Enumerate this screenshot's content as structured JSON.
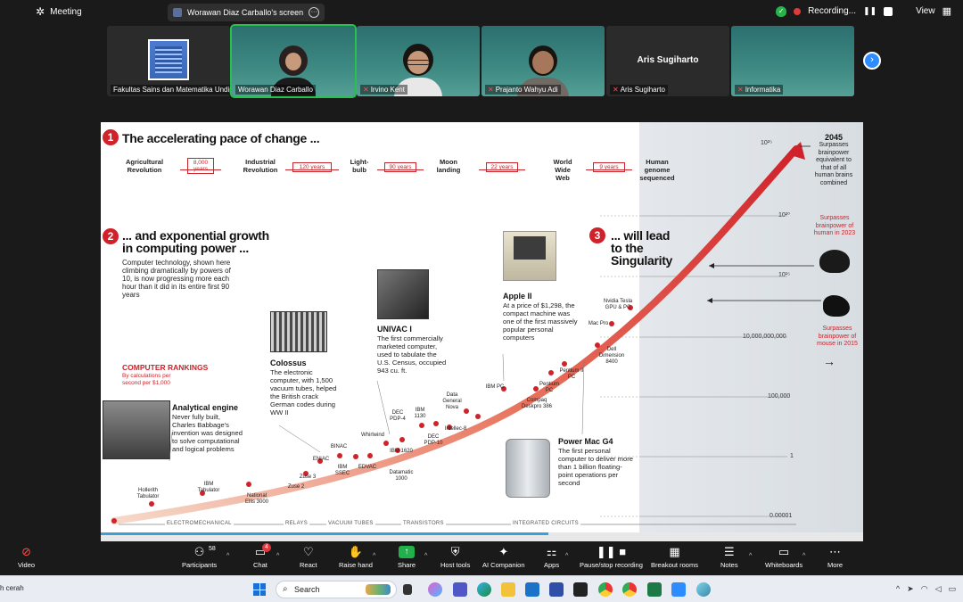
{
  "topbar": {
    "meeting_label": "Meeting",
    "share_label": "Worawan Diaz Carballo's screen",
    "recording_label": "Recording...",
    "view_label": "View"
  },
  "participants": [
    {
      "name": "Fakultas Sains dan Matematika Undip",
      "muted": false,
      "type": "building"
    },
    {
      "name": "Worawan Diaz Carballo",
      "muted": false,
      "type": "person-slide",
      "active": true
    },
    {
      "name": "Irvino Kent",
      "muted": true,
      "type": "person-slide"
    },
    {
      "name": "Prajanto Wahyu Adi",
      "muted": true,
      "type": "person-slide"
    },
    {
      "name": "Aris Sugiharto",
      "muted": true,
      "type": "name-only",
      "display": "Aris Sugiharto"
    },
    {
      "name": "Informatika",
      "muted": true,
      "type": "slide"
    }
  ],
  "slide": {
    "sec1_num": "1",
    "sec1_title": "The accelerating pace of change ...",
    "timeline": [
      {
        "label": "Agricultural\nRevolution"
      },
      {
        "box": "8,000\nyears"
      },
      {
        "label": "Industrial\nRevolution"
      },
      {
        "box": "120 years"
      },
      {
        "label": "Light-\nbulb"
      },
      {
        "box": "90 years"
      },
      {
        "label": "Moon\nlanding"
      },
      {
        "box": "22 years"
      },
      {
        "label": "World\nWide\nWeb"
      },
      {
        "box": "9 years"
      },
      {
        "label": "Human\ngenome\nsequenced"
      }
    ],
    "sec2_num": "2",
    "sec2_title": "... and exponential growth\nin computing power ...",
    "sec2_desc": "Computer technology, shown here climbing dramatically by powers of 10, is now progressing more each hour than it did in its entire first 90 years",
    "sec3_num": "3",
    "sec3_title": "... will lead\nto the\nSingularity",
    "rankings_title": "COMPUTER RANKINGS",
    "rankings_sub": "By calculations per second per $1,000",
    "y_ticks": [
      "10²⁵",
      "10²⁰",
      "10¹⁵",
      "10,000,000,000",
      "100,000",
      "1",
      "0.00001"
    ],
    "year_2045": "2045",
    "note_2045": "Surpasses brainpower equivalent to that of all human brains combined",
    "note_human": "Surpasses brainpower of human in 2023",
    "note_mouse": "Surpasses brainpower of mouse in 2015",
    "items": [
      {
        "title": "Analytical engine",
        "desc": "Never fully built, Charles Babbage's invention was designed to solve computational and logical problems"
      },
      {
        "title": "Colossus",
        "desc": "The electronic computer, with 1,500 vacuum tubes, helped the British crack German codes during WW II"
      },
      {
        "title": "UNIVAC I",
        "desc": "The first commercially marketed computer, used to tabulate the U.S. Census, occupied 943 cu. ft."
      },
      {
        "title": "Apple II",
        "desc": "At a price of $1,298, the compact machine was one of the first massively popular personal computers"
      },
      {
        "title": "Power Mac G4",
        "desc": "The first personal computer to deliver more than 1 billion floating-point operations per second"
      }
    ],
    "point_labels": [
      "Hollerith Tabulator",
      "IBM Tabulator",
      "National Ellis 3000",
      "Zuse 2",
      "Zuse 3",
      "ENIAC",
      "BINAC",
      "IBM SSEC",
      "EDVAC",
      "Whirlwind",
      "IBM 1620",
      "Datamatic 1000",
      "DEC PDP-4",
      "IBM 1130",
      "DEC PDP-10",
      "Data General Nova",
      "Intellec-8",
      "IBM PC",
      "Compaq Deskpro 386",
      "Pentium PC",
      "Pentium II PC",
      "Dell Dimension 8400",
      "Mac Pro",
      "Nvidia Tesla GPU & PC"
    ],
    "eras": [
      "ELECTROMECHANICAL",
      "RELAYS",
      "VACUUM TUBES",
      "TRANSISTORS",
      "INTEGRATED CIRCUITS"
    ]
  },
  "toolbar": {
    "video": "Video",
    "participants": "Participants",
    "participants_count": "58",
    "chat": "Chat",
    "chat_badge": "4",
    "react": "React",
    "raise_hand": "Raise hand",
    "share": "Share",
    "host_tools": "Host tools",
    "ai_companion": "AI Companion",
    "apps": "Apps",
    "pause_recording": "Pause/stop recording",
    "breakout_rooms": "Breakout rooms",
    "notes": "Notes",
    "whiteboards": "Whiteboards",
    "more": "More"
  },
  "taskbar": {
    "weather": "h cerah",
    "search_placeholder": "Search"
  }
}
